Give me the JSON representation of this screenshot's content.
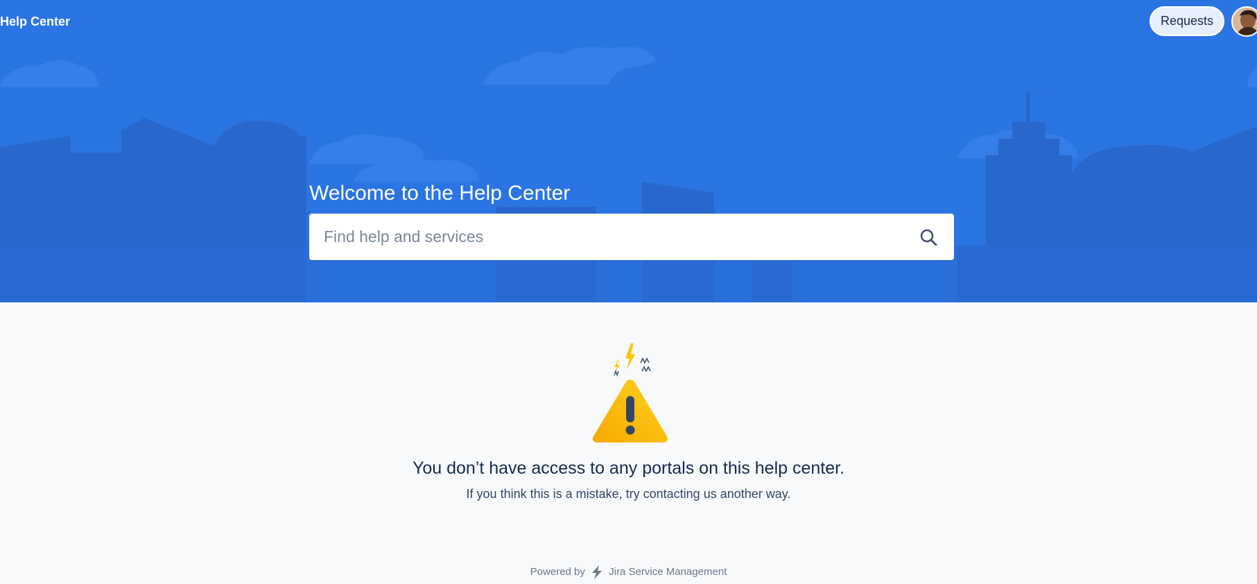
{
  "header": {
    "title": "Help Center",
    "requests_label": "Requests"
  },
  "hero": {
    "welcome": "Welcome to the Help Center",
    "search_placeholder": "Find help and services"
  },
  "message": {
    "title": "You don’t have access to any portals on this help center.",
    "subtitle": "If you think this is a mistake, try contacting us another way."
  },
  "footer": {
    "powered_by": "Powered by",
    "product": "Jira Service Management"
  },
  "colors": {
    "hero_background": "#2b75e2",
    "page_background": "#f7f9fb",
    "warning_yellow": "#ffc400",
    "text_dark": "#172b4d"
  }
}
